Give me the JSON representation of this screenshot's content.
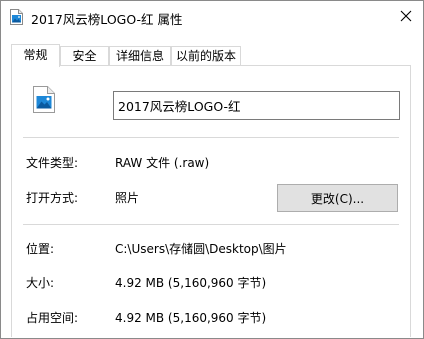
{
  "window": {
    "title": "2017风云榜LOGO-红 属性",
    "close_glyph": "✕",
    "icon": "image-file-icon"
  },
  "tabs": [
    {
      "label": "常规",
      "active": true
    },
    {
      "label": "安全",
      "active": false
    },
    {
      "label": "详细信息",
      "active": false
    },
    {
      "label": "以前的版本",
      "active": false
    }
  ],
  "general": {
    "file_icon": "image-file-icon",
    "file_name": "2017风云榜LOGO-红",
    "file_type_label": "文件类型:",
    "file_type_value": "RAW 文件 (.raw)",
    "opens_with_label": "打开方式:",
    "opens_with_value": "照片",
    "change_button": "更改(C)...",
    "location_label": "位置:",
    "location_value": "C:\\Users\\存储圆\\Desktop\\图片",
    "size_label": "大小:",
    "size_value": "4.92 MB (5,160,960 字节)",
    "size_on_disk_label": "占用空间:",
    "size_on_disk_value": "4.92 MB (5,160,960 字节)"
  },
  "colors": {
    "icon_blue": "#1e88d8",
    "border": "#d9d9d9",
    "button_bg": "#e1e1e1"
  }
}
